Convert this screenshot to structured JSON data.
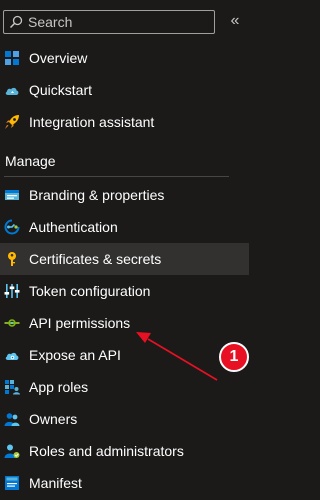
{
  "search": {
    "placeholder": "Search"
  },
  "collapse_label": "«",
  "nav_top": [
    {
      "label": "Overview",
      "icon": "overview-icon"
    },
    {
      "label": "Quickstart",
      "icon": "quickstart-cloud-icon"
    },
    {
      "label": "Integration assistant",
      "icon": "rocket-icon"
    }
  ],
  "manage": {
    "header": "Manage",
    "items": [
      {
        "label": "Branding & properties",
        "icon": "branding-icon"
      },
      {
        "label": "Authentication",
        "icon": "authentication-icon"
      },
      {
        "label": "Certificates & secrets",
        "icon": "key-icon",
        "selected": true
      },
      {
        "label": "Token configuration",
        "icon": "token-config-icon"
      },
      {
        "label": "API permissions",
        "icon": "api-permissions-icon"
      },
      {
        "label": "Expose an API",
        "icon": "expose-api-cloud-icon"
      },
      {
        "label": "App roles",
        "icon": "app-roles-icon"
      },
      {
        "label": "Owners",
        "icon": "owners-icon"
      },
      {
        "label": "Roles and administrators",
        "icon": "roles-admin-icon"
      },
      {
        "label": "Manifest",
        "icon": "manifest-icon"
      }
    ]
  },
  "annotation": {
    "badge_text": "1"
  },
  "colors": {
    "background": "#1b1a19",
    "selected": "#323130",
    "annotation_red": "#e81123",
    "accent_blue": "#0078d4",
    "key_yellow": "#ffb900"
  }
}
